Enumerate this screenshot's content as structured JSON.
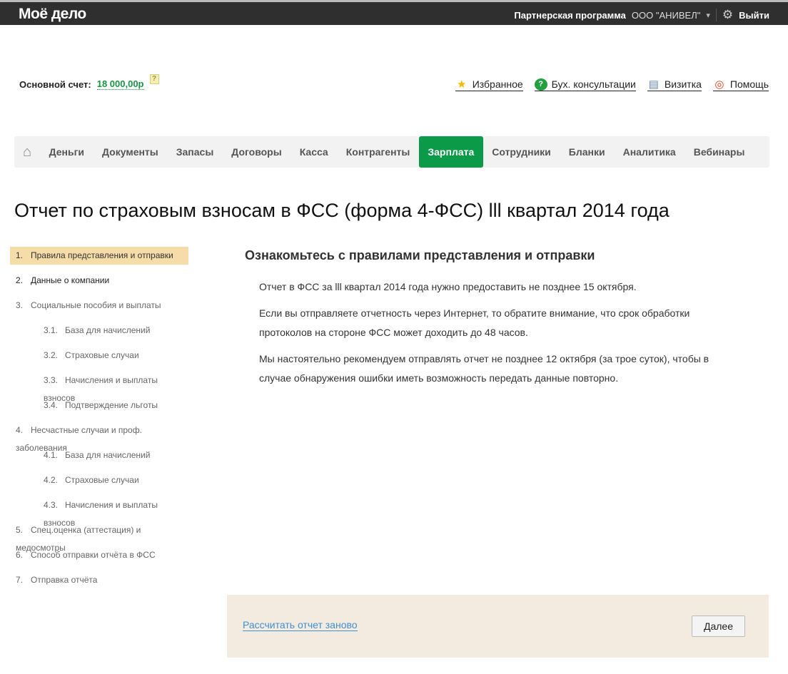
{
  "topbar": {
    "logo": "Моё дело",
    "partner": "Партнерская программа",
    "org": "ООО \"АНИВЕЛ\"",
    "dropdown": "▾",
    "logout": "Выйти"
  },
  "account": {
    "label": "Основной счет:",
    "sum": "18 000,00р",
    "help": "?"
  },
  "links": [
    {
      "label": "Избранное",
      "icon": "star-icon"
    },
    {
      "label": "Бух. консультации",
      "icon": "question-icon"
    },
    {
      "label": "Визитка",
      "icon": "card-icon"
    },
    {
      "label": "Помощь",
      "icon": "lifebuoy-icon"
    }
  ],
  "nav": {
    "items": [
      "Деньги",
      "Документы",
      "Запасы",
      "Договоры",
      "Касса",
      "Контрагенты",
      "Зарплата",
      "Сотрудники",
      "Бланки",
      "Аналитика",
      "Вебинары"
    ],
    "active": "Зарплата",
    "active_color": "#0b9a47"
  },
  "page_title": "Отчет по страховым взносам в ФСС (форма 4-ФСС) lll квартал 2014 года",
  "steps": [
    {
      "num": "1.",
      "label": "Правила представления и отправки"
    },
    {
      "num": "2.",
      "label": "Данные о компании"
    },
    {
      "num": "3.",
      "label": "Социальные пособия и выплаты"
    },
    {
      "num": "3.1.",
      "label": "База для начислений"
    },
    {
      "num": "3.2.",
      "label": "Страховые случаи"
    },
    {
      "num": "3.3.",
      "label": "Начисления и выплаты взносов"
    },
    {
      "num": "3.4.",
      "label": "Подтверждение льготы"
    },
    {
      "num": "4.",
      "label": "Несчастные случаи и проф. заболевания"
    },
    {
      "num": "4.1.",
      "label": "База для начислений"
    },
    {
      "num": "4.2.",
      "label": "Страховые случаи"
    },
    {
      "num": "4.3.",
      "label": "Начисления и выплаты взносов"
    },
    {
      "num": "5.",
      "label": "Спец.оценка (аттестация) и медосмотры"
    },
    {
      "num": "6.",
      "label": "Способ отправки отчёта в ФСС"
    },
    {
      "num": "7.",
      "label": "Отправка отчёта"
    }
  ],
  "content": {
    "heading": "Ознакомьтесь с правилами представления и отправки",
    "paragraphs": [
      "Отчет в ФСС за lll квартал 2014 года нужно предоставить не позднее 15 октября.",
      "Если вы отправляете отчетность через Интернет, то обратите внимание, что срок обработки протоколов на стороне ФСС может доходить до 48 часов.",
      "Мы настоятельно рекомендуем отправлять отчет не позднее 12 октября (за трое суток), чтобы в случае обнаружения ошибки иметь возможность передать данные повторно."
    ]
  },
  "footer": {
    "recalc": "Рассчитать отчет заново",
    "next": "Далее"
  }
}
